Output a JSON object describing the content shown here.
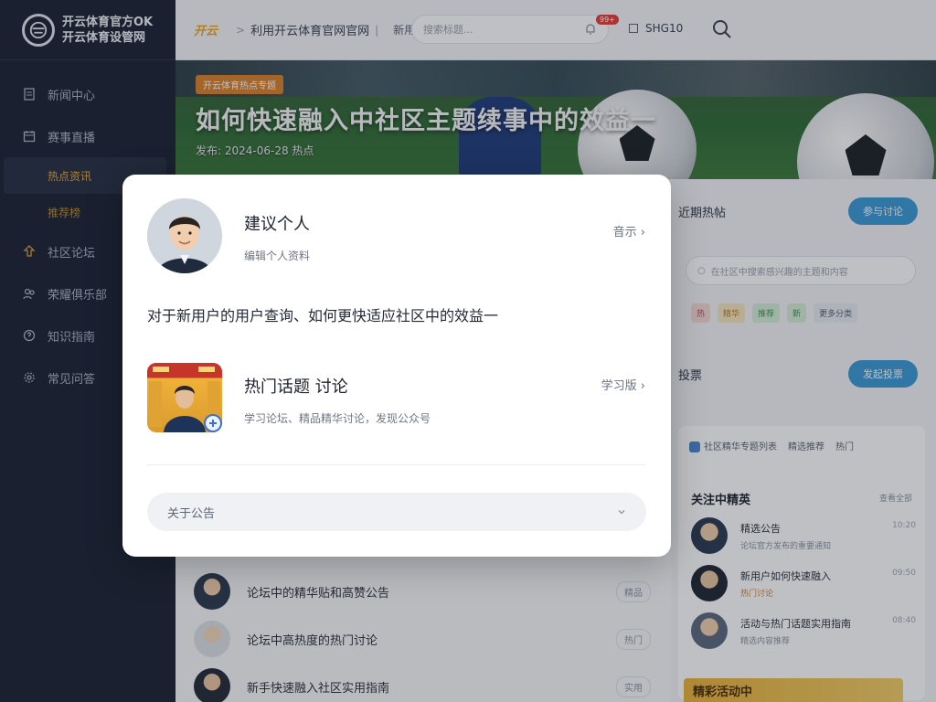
{
  "sidebar": {
    "logo_line1": "开云体育官方OK",
    "logo_line2": "开云体育设管网",
    "items": [
      {
        "label": "新闻中心"
      },
      {
        "label": "赛事直播"
      },
      {
        "label": "热点资讯"
      },
      {
        "label": "推荐榜"
      },
      {
        "label": "社区论坛"
      },
      {
        "label": "荣耀俱乐部"
      },
      {
        "label": "知识指南"
      },
      {
        "label": "常见问答"
      }
    ]
  },
  "topbar": {
    "brand": "开云",
    "crumb": "利用开云体育官网官网",
    "crumb_extra": "新用户操作指南",
    "search_placeholder": "搜索标题...",
    "notify_badge": "99+",
    "user_label": "SHG10"
  },
  "hero": {
    "tag": "开云体育热点专题",
    "title": "如何快速融入中社区主题续事中的效益一",
    "subtitle": "发布: 2024-06-28 热点"
  },
  "mainlist": {
    "items": [
      {
        "text": "论坛中的精华贴和高赞公告",
        "tag": "精品"
      },
      {
        "text": "论坛中高热度的热门讨论",
        "tag": "热门"
      },
      {
        "text": "新手快速融入社区实用指南",
        "tag": "实用"
      }
    ]
  },
  "rightcol": {
    "row1_label": "近期热帖",
    "row1_button": "参与讨论",
    "search_placeholder": "在社区中搜索感兴趣的主题和内容",
    "chips": [
      "热",
      "精华",
      "推荐",
      "新",
      "更多分类"
    ],
    "row2_label": "投票",
    "row2_button": "发起投票",
    "tabs": [
      "社区精华专题列表",
      "精选推荐",
      "热门"
    ],
    "hot_title": "关注中精英",
    "hot_more": "查看全部",
    "hot_items": [
      {
        "title": "精选公告",
        "sub": "论坛官方发布的重要通知",
        "time": "10:20"
      },
      {
        "title": "新用户如何快速融入",
        "sub": "热门讨论",
        "time": "09:50"
      },
      {
        "title": "活动与热门话题实用指南",
        "sub": "精选内容推荐",
        "time": "08:40"
      }
    ],
    "bottom_banner": "精彩活动中"
  },
  "modal": {
    "name": "建议个人",
    "subtitle": "编辑个人资料",
    "hint": "音示 ›",
    "description": "对于新用户的用户查询、如何更快适应社区中的效益一",
    "topic_title": "热门话题 讨论",
    "topic_sub": "学习论坛、精品精华讨论，发现公众号",
    "topic_hint": "学习版 ›",
    "select_label": "关于公告"
  },
  "colors": {
    "sidebar_bg": "#1b2233",
    "accent": "#e8a93a",
    "primary_button": "#3b9ad6",
    "badge_red": "#e0403a"
  }
}
